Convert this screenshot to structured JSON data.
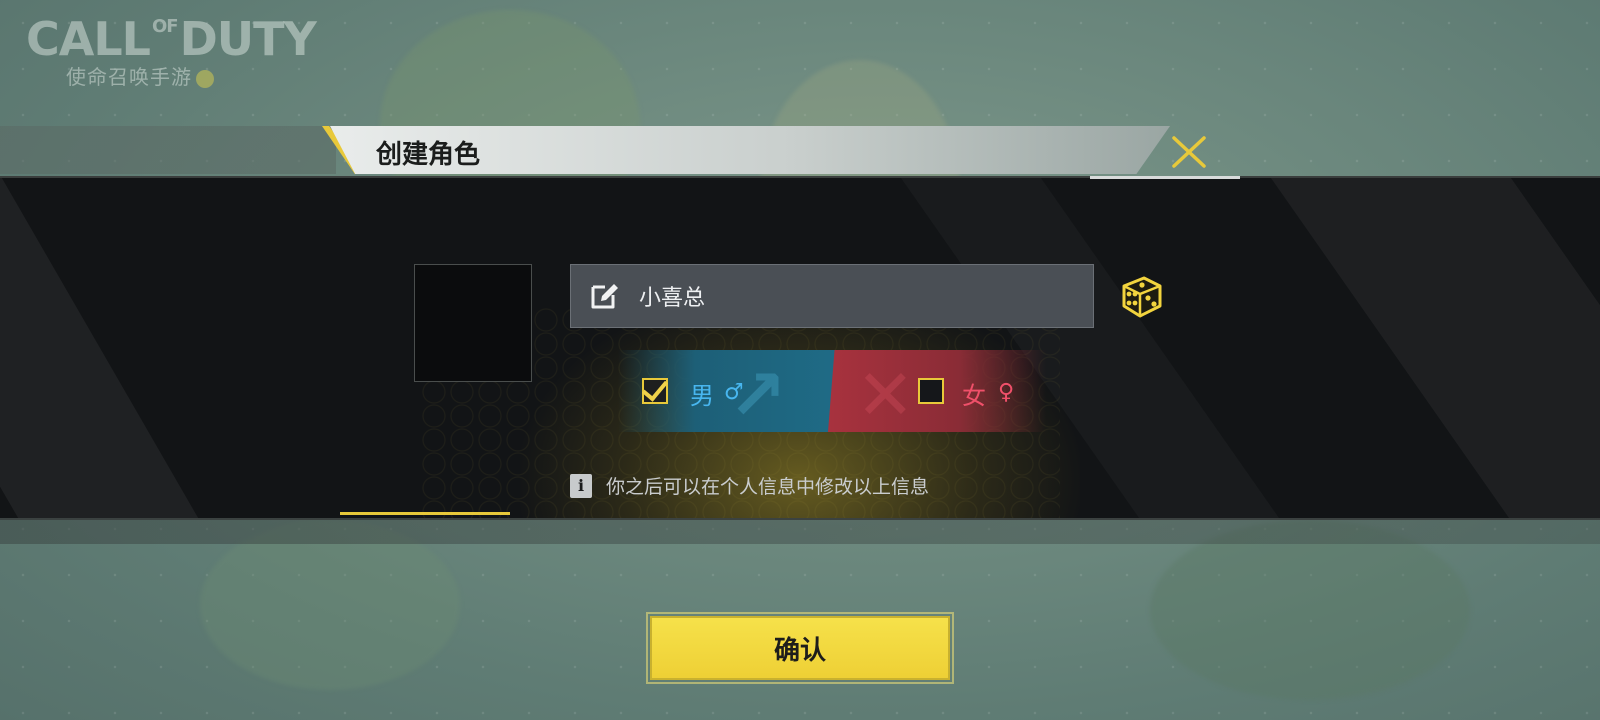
{
  "logo": {
    "main_before": "CALL",
    "main_of": "OF",
    "main_after": "DUTY",
    "subtitle": "使命召唤手游"
  },
  "dialog": {
    "title": "创建角色",
    "close_icon": "close-x-icon"
  },
  "form": {
    "name_value": "小喜总",
    "edit_icon": "edit-pencil-icon",
    "random_icon": "dice-icon",
    "gender": {
      "male_label": "男",
      "male_symbol": "♂",
      "male_checked": true,
      "female_label": "女",
      "female_symbol": "♀",
      "female_checked": false
    },
    "info_icon": "info-icon",
    "info_text": "你之后可以在个人信息中修改以上信息"
  },
  "actions": {
    "confirm_label": "确认"
  },
  "colors": {
    "accent": "#e8c93a",
    "male": "#48b6ef",
    "female": "#f0506a",
    "panel": "#121416"
  }
}
